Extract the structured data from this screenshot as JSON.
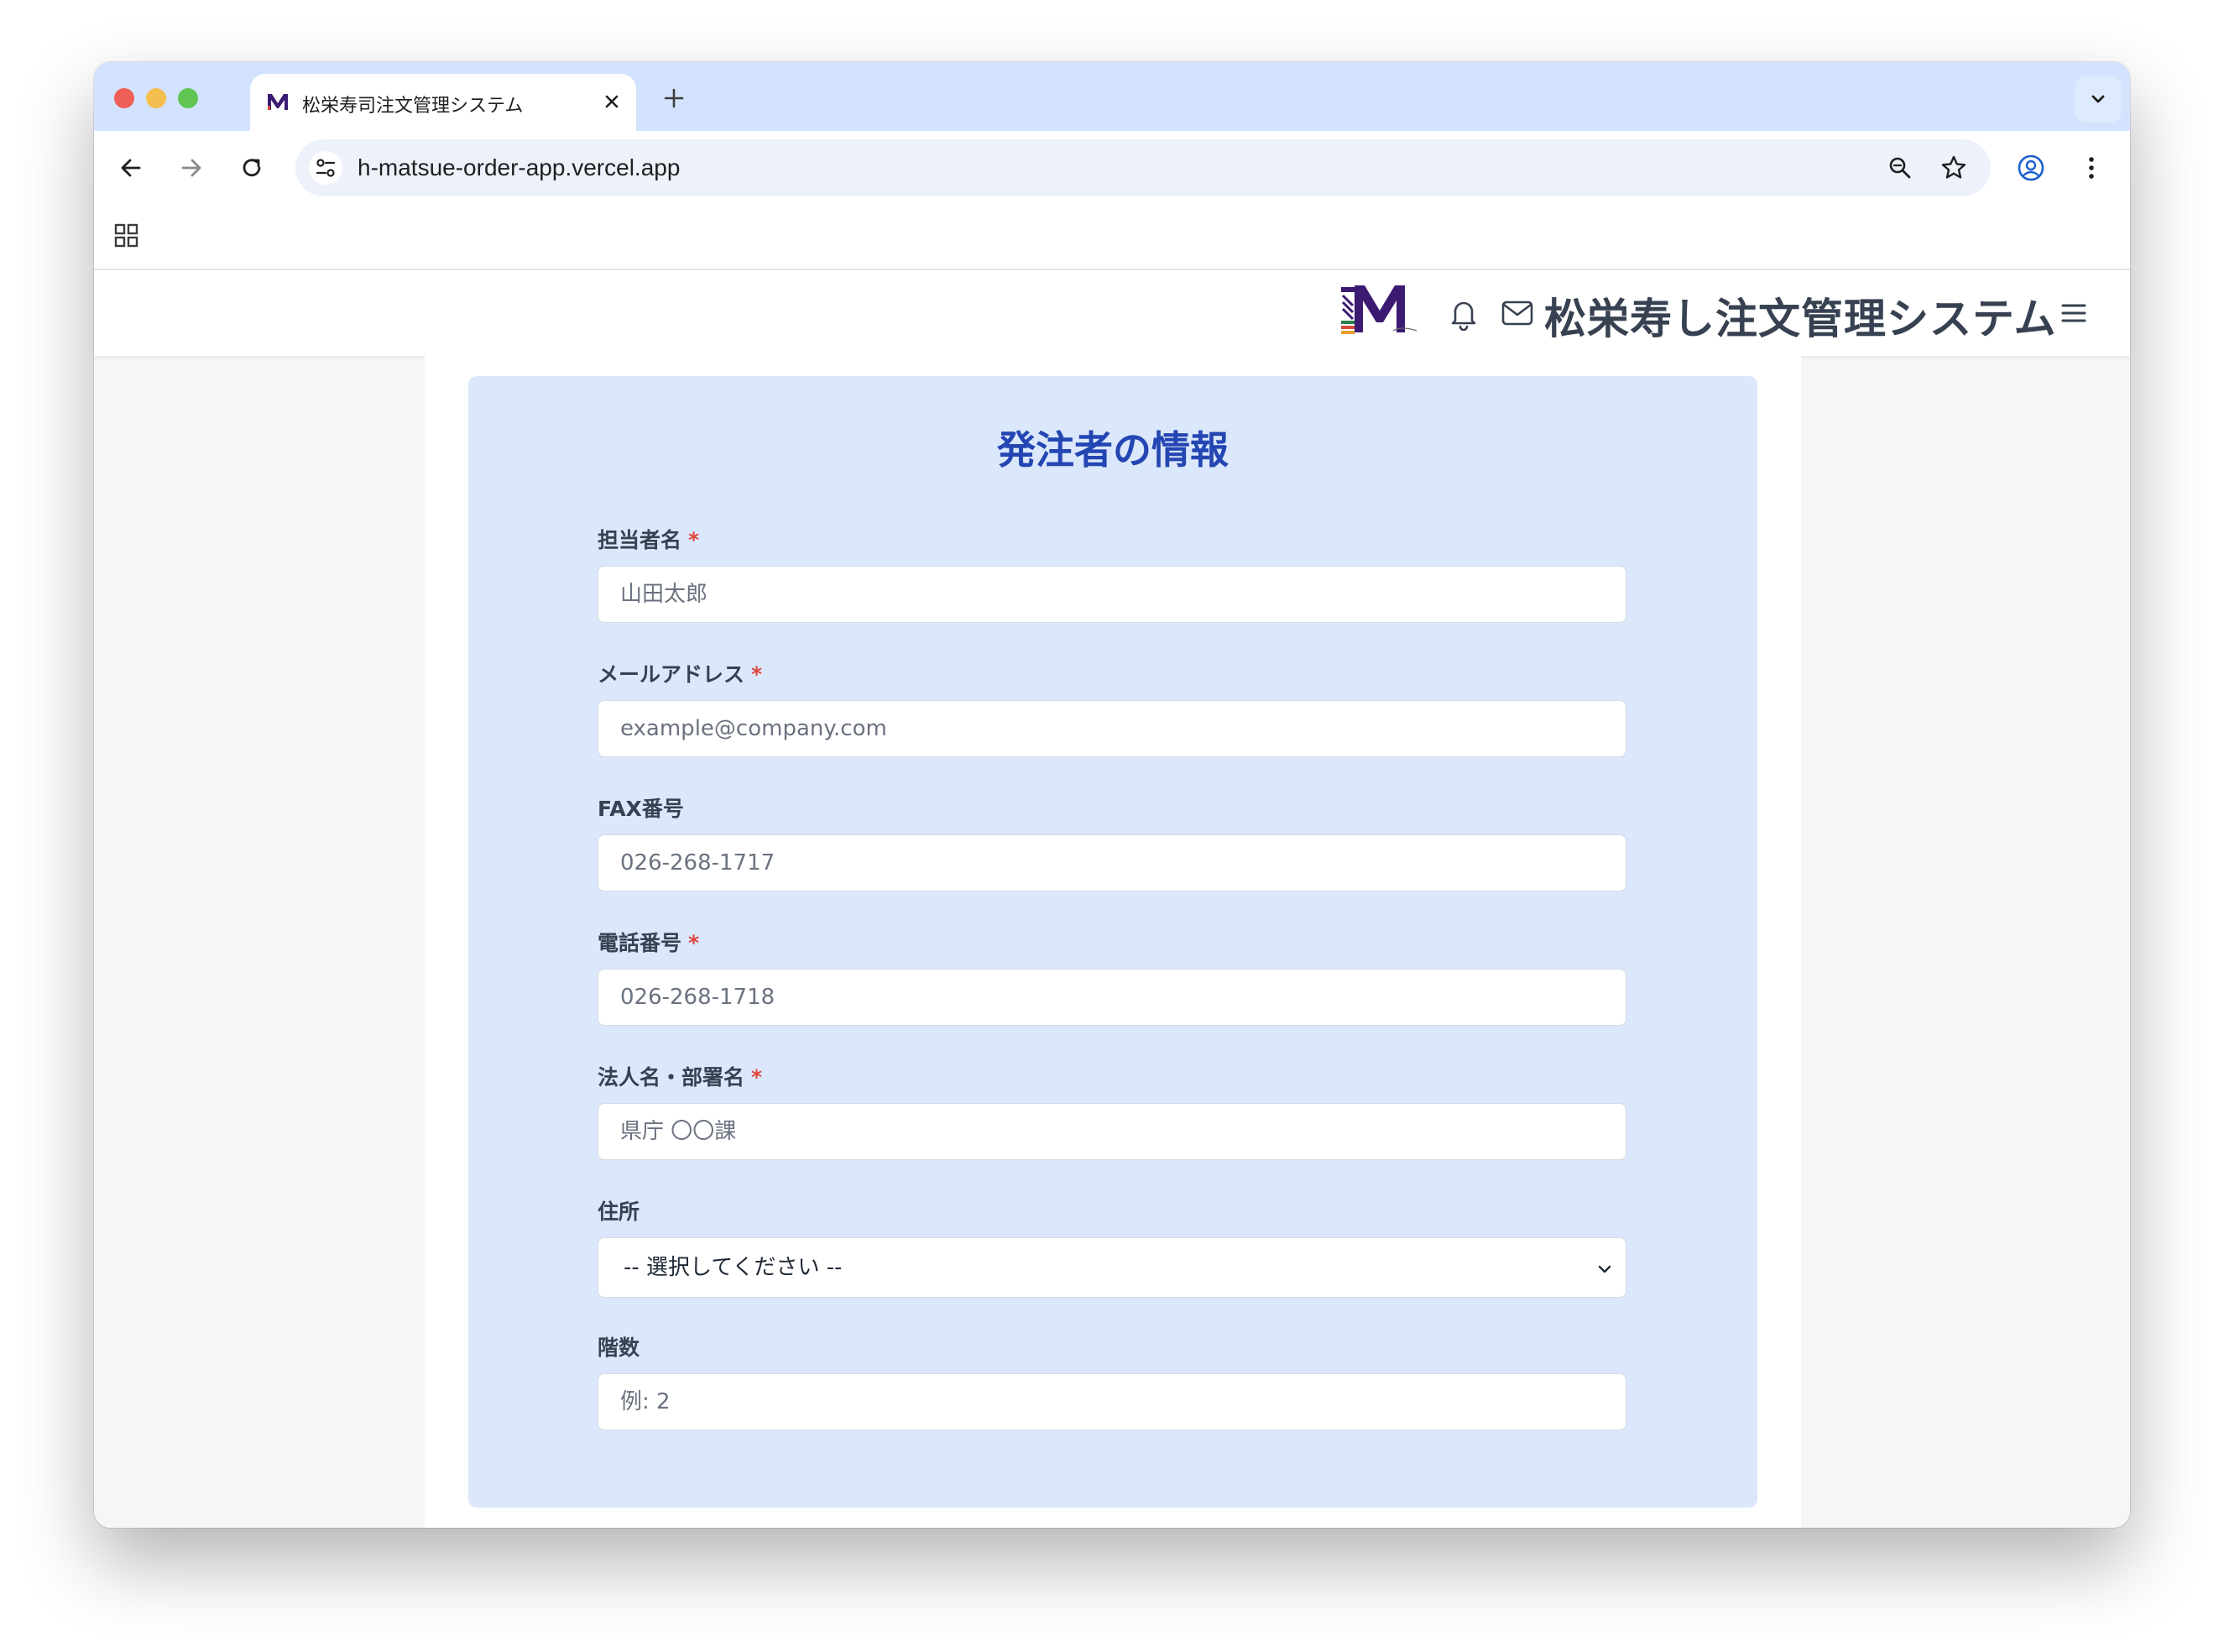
{
  "browser": {
    "tab_title": "松栄寿司注文管理システム",
    "url": "h-matsue-order-app.vercel.app",
    "traffic_light_colors": [
      "#ed5f57",
      "#f5bf4f",
      "#61c554"
    ]
  },
  "app": {
    "logo_letter": "M",
    "title": "松栄寿し注文管理システム",
    "icons": [
      "bell-icon",
      "mail-icon",
      "hamburger-menu-icon"
    ]
  },
  "form": {
    "heading": "発注者の情報",
    "required_mark": "*",
    "fields": [
      {
        "label": "担当者名",
        "required": true,
        "placeholder": "山田太郎"
      },
      {
        "label": "メールアドレス",
        "required": true,
        "placeholder": "example@company.com"
      },
      {
        "label": "FAX番号",
        "required": false,
        "placeholder": "026-268-1717"
      },
      {
        "label": "電話番号",
        "required": true,
        "placeholder": "026-268-1718"
      },
      {
        "label": "法人名・部署名",
        "required": true,
        "placeholder": "県庁 〇〇課"
      },
      {
        "label": "住所",
        "required": false,
        "selected": "-- 選択してください --"
      },
      {
        "label": "階数",
        "required": false,
        "placeholder": "例: 2"
      }
    ]
  },
  "colors": {
    "tab_strip": "#d3e3fd",
    "card_bg": "#dbe7fb",
    "heading": "#2346b3",
    "required": "#e0453a",
    "logo_purple": "#3b1a72"
  }
}
